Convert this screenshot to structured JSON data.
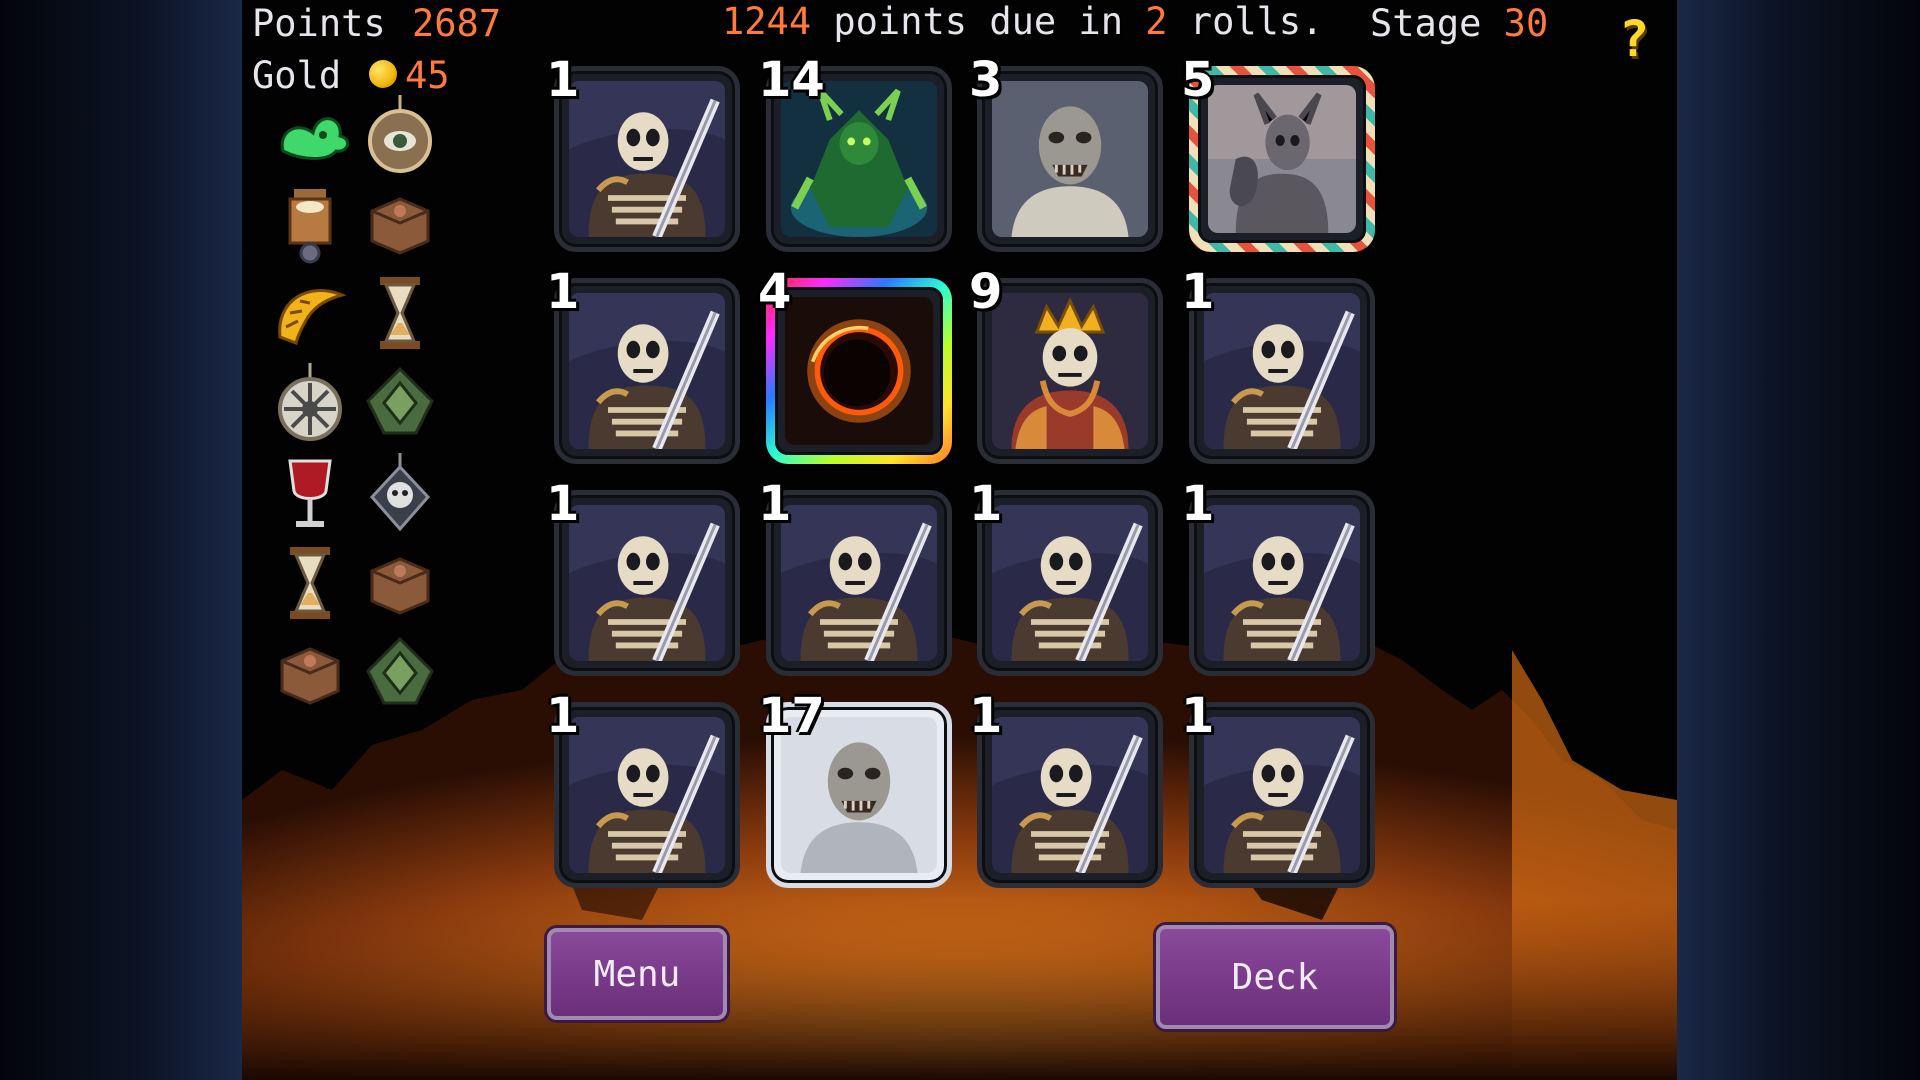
{
  "hud": {
    "points_label": "Points",
    "points_value": "2687",
    "gold_label": "Gold",
    "gold_value": "45",
    "due_amount": "1244",
    "due_mid": " points due in ",
    "due_rolls": "2",
    "due_end": " rolls.",
    "stage_label": "Stage",
    "stage_value": "30",
    "help": "?"
  },
  "relics": [
    {
      "icon": "green-ghost-icon"
    },
    {
      "icon": "eye-amulet-icon"
    },
    {
      "icon": "lantern-icon"
    },
    {
      "icon": "wooden-token-icon"
    },
    {
      "icon": "golden-horn-icon"
    },
    {
      "icon": "hourglass-icon"
    },
    {
      "icon": "wheel-pendant-icon"
    },
    {
      "icon": "rune-stone-icon"
    },
    {
      "icon": "wine-goblet-icon"
    },
    {
      "icon": "skull-medallion-icon"
    },
    {
      "icon": "hourglass-icon"
    },
    {
      "icon": "wooden-token-icon"
    },
    {
      "icon": "wooden-token-icon"
    },
    {
      "icon": "rune-stone-icon"
    }
  ],
  "cards": [
    {
      "value": "1",
      "kind": "skeleton-warrior"
    },
    {
      "value": "14",
      "kind": "green-demon"
    },
    {
      "value": "3",
      "kind": "zombie"
    },
    {
      "value": "5",
      "kind": "skeleton-knight-striped"
    },
    {
      "value": "1",
      "kind": "skeleton-warrior"
    },
    {
      "value": "4",
      "kind": "eclipse-rainbow"
    },
    {
      "value": "9",
      "kind": "skeleton-king"
    },
    {
      "value": "1",
      "kind": "skeleton-warrior"
    },
    {
      "value": "1",
      "kind": "skeleton-warrior"
    },
    {
      "value": "1",
      "kind": "skeleton-warrior"
    },
    {
      "value": "1",
      "kind": "skeleton-warrior"
    },
    {
      "value": "1",
      "kind": "skeleton-warrior"
    },
    {
      "value": "1",
      "kind": "skeleton-warrior"
    },
    {
      "value": "17",
      "kind": "zombie-holo"
    },
    {
      "value": "1",
      "kind": "skeleton-warrior"
    },
    {
      "value": "1",
      "kind": "skeleton-warrior"
    }
  ],
  "buttons": {
    "menu": "Menu",
    "deck": "Deck"
  },
  "colors": {
    "highlight": "#ff7a3c",
    "button": "#7a3c8a",
    "help": "#ffd92a"
  }
}
